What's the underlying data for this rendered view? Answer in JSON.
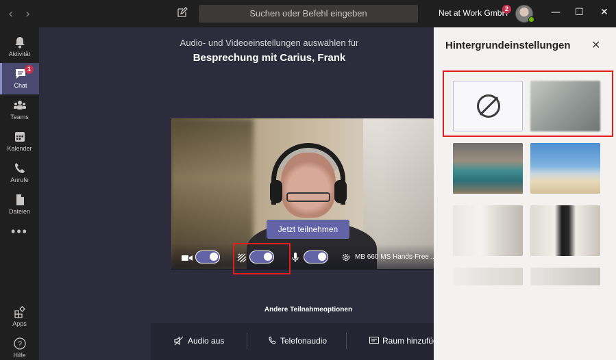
{
  "titlebar": {
    "back_icon": "chevron-left-icon",
    "forward_icon": "chevron-right-icon",
    "search_placeholder": "Suchen oder Befehl eingeben",
    "org_name": "Net at Work GmbH",
    "org_badge": "2",
    "minimize": "—",
    "maximize": "☐",
    "close": "✕"
  },
  "rail": {
    "items": [
      {
        "label": "Aktivität",
        "icon": "bell-icon"
      },
      {
        "label": "Chat",
        "icon": "chat-icon",
        "badge": "1",
        "active": true
      },
      {
        "label": "Teams",
        "icon": "teams-icon"
      },
      {
        "label": "Kalender",
        "icon": "calendar-icon"
      },
      {
        "label": "Anrufe",
        "icon": "phone-icon"
      },
      {
        "label": "Dateien",
        "icon": "file-icon"
      }
    ],
    "more": "•••",
    "apps_label": "Apps",
    "help_label": "Hilfe"
  },
  "stage": {
    "subtitle": "Audio- und Videoeinstellungen auswählen für",
    "meeting_title": "Besprechung mit Carius, Frank",
    "join_label": "Jetzt teilnehmen",
    "device_label": "MB 660 MS Hands-Free ...",
    "toggles": {
      "video": true,
      "background_blur": true,
      "microphone": true
    },
    "other_options_title": "Andere Teilnahmeoptionen",
    "options": [
      {
        "label": "Audio aus",
        "icon": "speaker-off-icon"
      },
      {
        "label": "Telefonaudio",
        "icon": "phone-icon"
      },
      {
        "label": "Raum hinzufüg",
        "icon": "cast-icon"
      }
    ]
  },
  "panel": {
    "title": "Hintergrundeinstellungen",
    "close": "✕",
    "backgrounds": [
      "none",
      "blur",
      "office",
      "beach",
      "room-1",
      "room-2",
      "room-3",
      "room-4"
    ]
  },
  "colors": {
    "accent": "#6264a7",
    "highlight": "#e61c1c",
    "stage_bg": "#2d2c3c",
    "rail_bg": "#201f1f"
  }
}
